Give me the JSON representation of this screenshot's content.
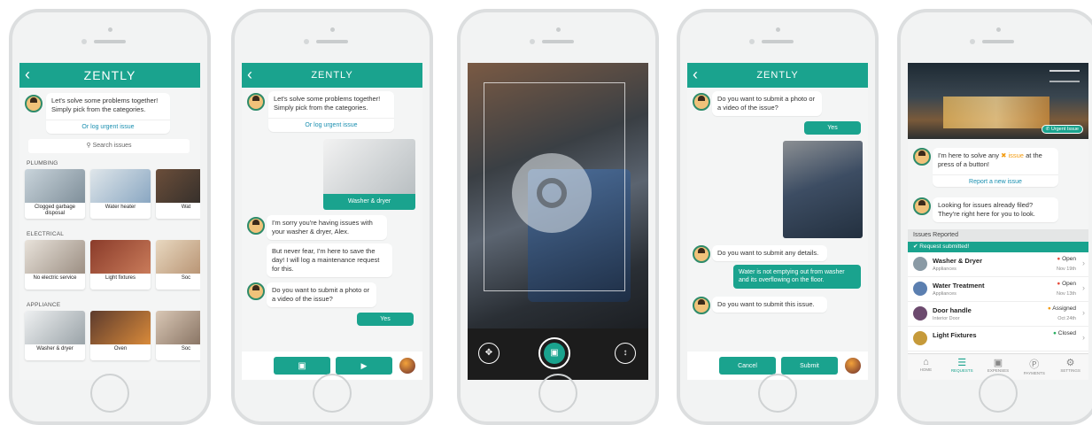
{
  "app": {
    "title": "ZENTLY"
  },
  "phone1": {
    "greeting": "Let's solve some problems together! Simply pick from the categories.",
    "urgent_link": "Or log urgent issue",
    "search_placeholder": "Search issues",
    "sections": [
      {
        "title": "PLUMBING",
        "cards": [
          "Clogged garbage disposal",
          "Water heater",
          "Wat"
        ]
      },
      {
        "title": "ELECTRICAL",
        "cards": [
          "No electric service",
          "Light fixtures",
          "Soc"
        ]
      },
      {
        "title": "APPLIANCE",
        "cards": [
          "Washer & dryer",
          "Oven",
          "Soc"
        ]
      }
    ]
  },
  "phone2": {
    "greeting": "Let's solve some problems together! Simply pick from the categories.",
    "urgent_link": "Or log urgent issue",
    "selected_category": "Washer & dryer",
    "msg1": "I'm sorry you're having issues with your washer & dryer, Alex.",
    "msg2": "But never fear, I'm here to save the day! I will log a maintenance request for this.",
    "msg3": "Do you want to submit a photo or a video of the issue?",
    "reply": "Yes"
  },
  "phone4": {
    "msg1": "Do you want to submit a photo or a video of the issue?",
    "reply1": "Yes",
    "msg2": "Do you want to submit any details.",
    "reply2": "Water is not emptying out from washer and its overflowing on the floor.",
    "msg3": "Do you want to submit this issue.",
    "cancel": "Cancel",
    "submit": "Submit"
  },
  "phone5": {
    "urgent_button": "Urgent Issue",
    "msg1_pre": "I'm here to solve any",
    "msg1_issue": "issue",
    "msg1_post": "at the press of a button!",
    "report_link": "Report a new issue",
    "msg2": "Looking for issues already filed? They're right here for you to look.",
    "issues_header": "Issues Reported",
    "submitted_banner": "Request submitted!",
    "issues": [
      {
        "title": "Washer & Dryer",
        "category": "Appliances",
        "status": "Open",
        "date": "Nov 19th",
        "dot": "#e74c3c"
      },
      {
        "title": "Water Treatment",
        "category": "Appliances",
        "status": "Open",
        "date": "Nov 13th",
        "dot": "#e74c3c"
      },
      {
        "title": "Door handle",
        "category": "Interior Door",
        "status": "Assigned",
        "date": "Oct 24th",
        "dot": "#f39c12"
      },
      {
        "title": "Light Fixtures",
        "category": "",
        "status": "Closed",
        "date": "",
        "dot": "#27ae60"
      }
    ],
    "nav": [
      "HOME",
      "REQUESTS",
      "EXPENSES",
      "PAYMENTS",
      "SETTINGS"
    ]
  },
  "colors": {
    "accent": "#1aa38e",
    "link": "#1a8fb0"
  }
}
